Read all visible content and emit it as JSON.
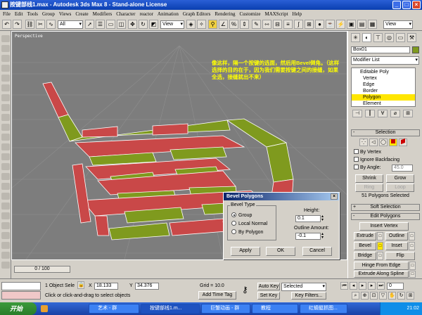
{
  "window": {
    "title": "按键部线1.max - Autodesk 3ds Max 8 - Stand-alone License",
    "minimize": "_",
    "maximize": "□",
    "close": "×"
  },
  "menu": [
    "File",
    "Edit",
    "Tools",
    "Group",
    "Views",
    "Create",
    "Modifiers",
    "Character",
    "reactor",
    "Animation",
    "Graph Editors",
    "Rendering",
    "Customize",
    "MAXScript",
    "Help"
  ],
  "toolbar": {
    "selection_filter": "All",
    "ref_coord_1": "View",
    "ref_coord_2": "View",
    "undo_icon": "↶",
    "redo_icon": "↷"
  },
  "viewport": {
    "label": "Perspective",
    "annotation": "像这样，隔一个按键的选面，然后用Bevel倒角。（这样选择的目的在于，因为我们需要按键之间的接缝，如果全选，接缝就出不来）"
  },
  "command_panel": {
    "object_name": "Box01",
    "modifier_list": "Modifier List",
    "stack": [
      "Editable Poly",
      "Vertex",
      "Edge",
      "Border",
      "Polygon",
      "Element"
    ],
    "stack_selected_index": 4,
    "selection_rollout": "Selection",
    "by_vertex": "By Vertex",
    "ignore_backfacing": "Ignore Backfacing",
    "by_angle": "By Angle:",
    "angle_value": "45.0",
    "shrink": "Shrink",
    "grow": "Grow",
    "ring": "Ring",
    "loop": "Loop",
    "selected_count": "51 Polygons Selected",
    "soft_selection": "Soft Selection",
    "edit_polygons": "Edit Polygons",
    "insert_vertex": "Insert Vertex",
    "extrude": "Extrude",
    "outline": "Outline",
    "bevel": "Bevel",
    "inset": "Inset",
    "bridge": "Bridge",
    "flip": "Flip",
    "hinge_from_edge": "Hinge From Edge",
    "extrude_along_spline": "Extrude Along Spline",
    "plus_sign": "+",
    "minus_sign": "-"
  },
  "dialog": {
    "title": "Bevel Polygons",
    "close": "×",
    "bevel_type_label": "Bevel Type",
    "options": [
      "Group",
      "Local Normal",
      "By Polygon"
    ],
    "selected_option": 0,
    "height_label": "Height:",
    "height_value": "0.1",
    "outline_label": "Outline Amount:",
    "outline_value": "-0.1",
    "apply": "Apply",
    "ok": "OK",
    "cancel": "Cancel"
  },
  "timebar": {
    "slider": "0 / 100"
  },
  "status": {
    "selection": "1 Object Sele",
    "prompt": "Click or click-and-drag to select objects",
    "x_label": "X",
    "x_value": "18.133",
    "y_label": "Y",
    "y_value": "34.376",
    "grid": "Grid = 10.0",
    "add_time_tag": "Add Time Tag",
    "auto_key": "Auto Key",
    "auto_key_value": "Selected",
    "set_key": "Set Key",
    "key_filters": "Key Filters...",
    "frame": "0"
  },
  "taskbar": {
    "start": "开始",
    "tasks": [
      "艺术 - 群",
      "按键部线1.m...",
      "巨蟹动画 - 群",
      "教程",
      "红蜻蜓抓图..."
    ],
    "clock": "21:02"
  },
  "colors": {
    "titlebar": "#0a3fb0",
    "selected_face": "#c94848",
    "unselected_face": "#7f9a1e",
    "annotation": "#ffff00",
    "stack_highlight": "#ffe600"
  }
}
